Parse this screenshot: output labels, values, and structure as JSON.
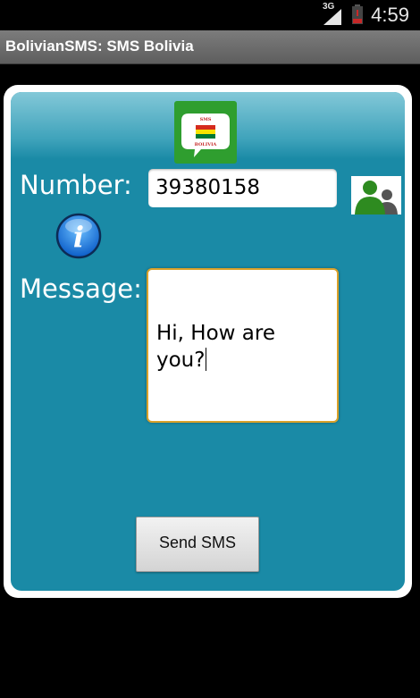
{
  "status_bar": {
    "network": "3G",
    "time": "4:59",
    "icons": [
      "signal-icon",
      "battery-icon"
    ]
  },
  "app": {
    "title": "BolivianSMS: SMS Bolivia"
  },
  "logo": {
    "top_text": "SMS",
    "bottom_text": "BOLIVIA",
    "flag_colors": [
      "#d52b1e",
      "#f9e300",
      "#007934"
    ]
  },
  "form": {
    "number_label": "Number:",
    "number_value": "39380158",
    "message_label": "Message:",
    "message_value": "Hi, How are you?",
    "send_label": "Send SMS"
  },
  "icons": {
    "contacts": "contacts-icon",
    "info": "info-icon"
  },
  "colors": {
    "panel": "#1a8aa6",
    "message_border": "#d9a12a"
  }
}
